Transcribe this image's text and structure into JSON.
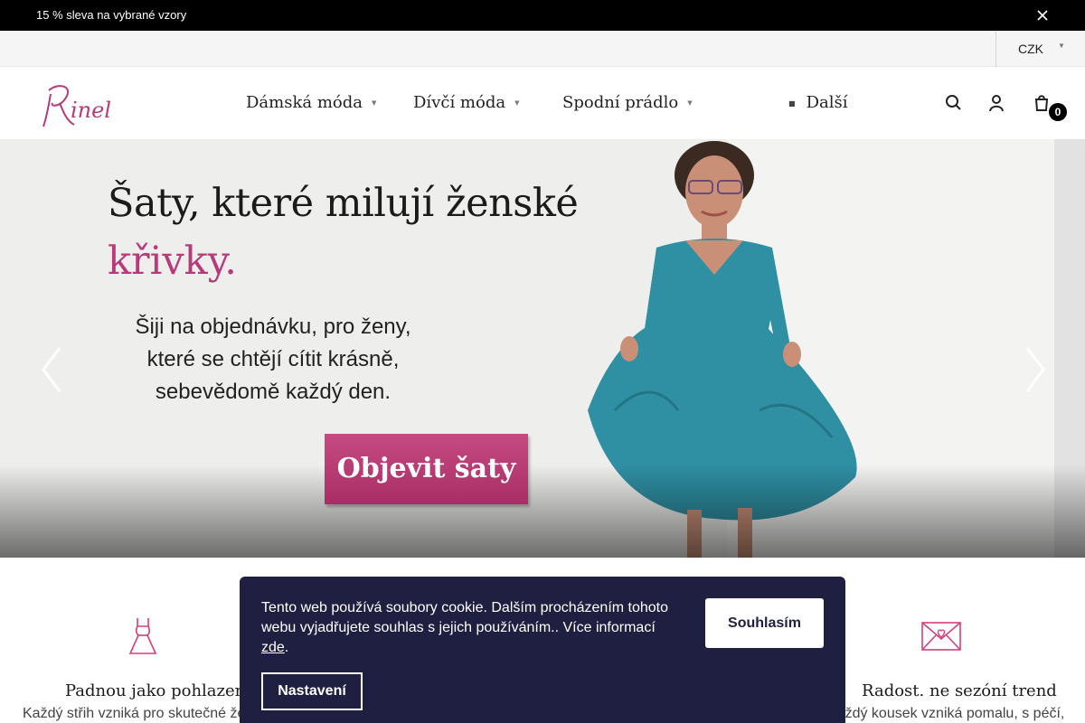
{
  "announcement": {
    "text": "15 % sleva na vybrané vzory",
    "close_icon": "close-icon"
  },
  "topbar": {
    "currency": "CZK",
    "currency_icon": "chevron-down-icon"
  },
  "header": {
    "logo_text": "Rinel",
    "brand_color": "#b83a7a",
    "nav": [
      {
        "label": "Dámská móda",
        "icon": "chevron-down-icon"
      },
      {
        "label": "Dívčí móda",
        "icon": "chevron-down-icon"
      },
      {
        "label": "Spodní prádlo",
        "icon": "chevron-down-icon"
      },
      {
        "label": "Další",
        "icon": "menu-icon"
      }
    ],
    "icons": [
      "search-icon",
      "user-icon",
      "cart-icon"
    ],
    "cart_count": "0"
  },
  "hero": {
    "title": "Šaty, které milují ženské",
    "title_accent": "křivky.",
    "subtitle_lines": [
      "Šiji na objednávku, pro ženy,",
      "které se chtějí cítit krásně,",
      "sebevědomě každý den."
    ],
    "cta": "Objevit šaty",
    "accent_color": "#b83a7a",
    "dress_color": "#2f8fa3",
    "arrows": [
      "chevron-left-icon",
      "chevron-right-icon"
    ]
  },
  "features": [
    {
      "icon": "dress-icon",
      "title": "Padnou jako pohlazení",
      "desc": "Každý střih vzniká pro skutečné ženy"
    },
    {
      "icon": "envelope-heart-icon",
      "title": "Radost. ne sezóní trend",
      "desc": "Každý kousek vzniká pomalu, s péčí,"
    }
  ],
  "cookie": {
    "text": "Tento web používá soubory cookie. Dalším procházením tohoto webu vyjadřujete souhlas s jejich používáním.. Více informací",
    "link": "zde",
    "after_link": ".",
    "accept": "Souhlasím",
    "settings": "Nastavení",
    "background": "#1f2041"
  }
}
